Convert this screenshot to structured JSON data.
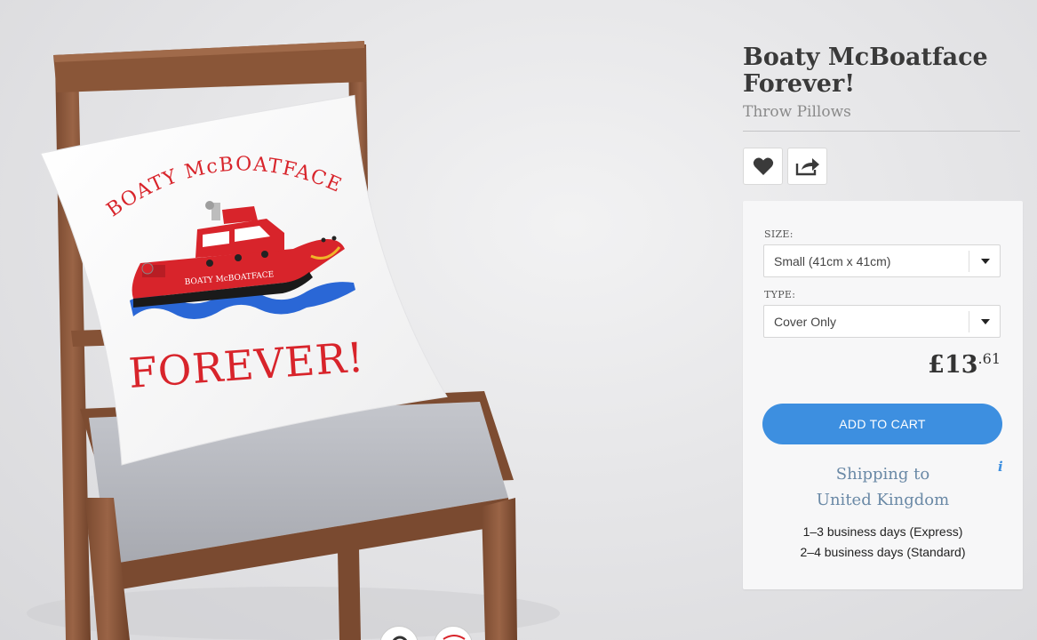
{
  "product": {
    "title_line1": "Boaty McBoatface",
    "title_line2": "Forever!",
    "category": "Throw Pillows"
  },
  "artwork": {
    "arc_text": "BOATY McBOATFACE",
    "hull_text": "BOATY McBOATFACE",
    "bottom_text": "FOREVER!"
  },
  "actions": {
    "favorite_icon": "heart-icon",
    "share_icon": "share-icon"
  },
  "options": {
    "size_label": "SIZE:",
    "size_value": "Small (41cm x 41cm)",
    "type_label": "TYPE:",
    "type_value": "Cover Only"
  },
  "price": {
    "major": "£13",
    "minor": ".61"
  },
  "cart": {
    "button_label": "ADD TO CART"
  },
  "shipping": {
    "info_icon": "i",
    "heading_line1": "Shipping to",
    "heading_line2": "United Kingdom",
    "express": "1–3 business days (Express)",
    "standard": "2–4 business days (Standard)"
  },
  "colors": {
    "accent": "#3d8fe0",
    "artwork_red": "#d8242b",
    "water_blue": "#2a67d6"
  }
}
